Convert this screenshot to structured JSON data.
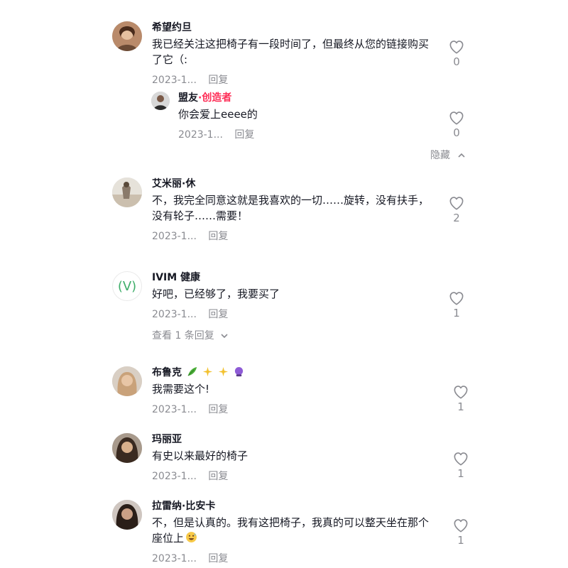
{
  "comments": [
    {
      "username": "希望约旦",
      "text": "我已经关注这把椅子有一段时间了，但最终从您的链接购买了它（:",
      "date": "2023-1...",
      "reply_label": "回复",
      "likes": "0",
      "reply": {
        "username": "盟友",
        "creator_tag": "·创造者",
        "text": "你会爱上eeee的",
        "date": "2023-1...",
        "reply_label": "回复",
        "likes": "0"
      },
      "hide_label": "隐藏"
    },
    {
      "username": "艾米丽·休",
      "text": "不，我完全同意这就是我喜欢的一切……旋转，没有扶手，没有轮子……需要！",
      "date": "2023-1...",
      "reply_label": "回复",
      "likes": "2"
    },
    {
      "username": "IVIM 健康",
      "avatar_text": "(V)",
      "text": "好吧，已经够了，我要买了",
      "date": "2023-1...",
      "reply_label": "回复",
      "likes": "1",
      "view_replies": "查看 1 条回复"
    },
    {
      "username": "布鲁克",
      "text": "我需要这个!",
      "date": "2023-1...",
      "reply_label": "回复",
      "likes": "1"
    },
    {
      "username": "玛丽亚",
      "text": "有史以来最好的椅子",
      "date": "2023-1...",
      "reply_label": "回复",
      "likes": "1"
    },
    {
      "username": "拉雷纳·比安卡",
      "text": "不，但是认真的。我有这把椅子，我真的可以整天坐在那个座位上",
      "date": "2023-1...",
      "reply_label": "回复",
      "likes": "1"
    }
  ],
  "colors": {
    "accent": "#fe2c55",
    "muted": "#8a8b91",
    "text": "#161823"
  }
}
